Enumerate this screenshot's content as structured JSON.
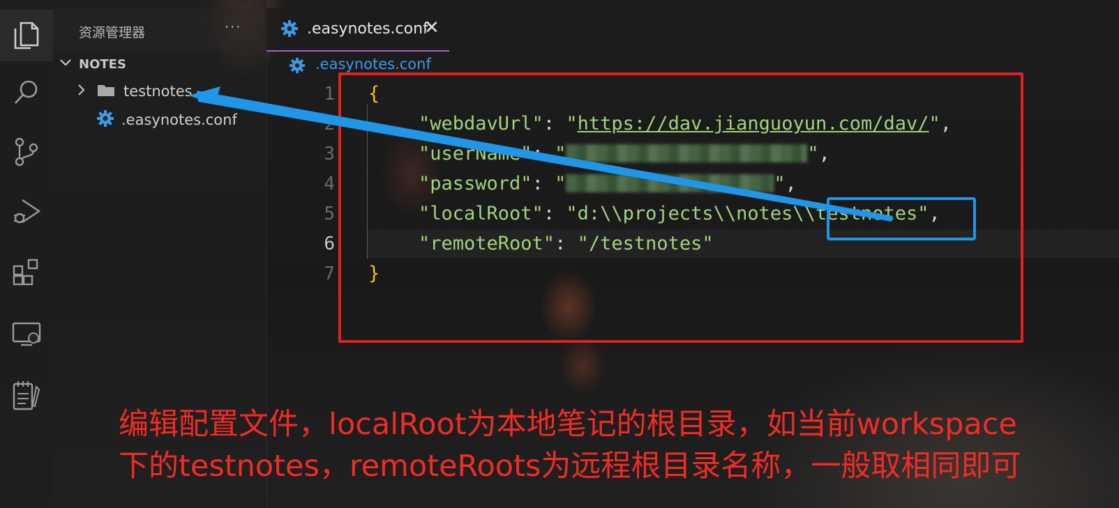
{
  "sidebar": {
    "title": "资源管理器",
    "more": "···",
    "section": "NOTES",
    "items": [
      {
        "label": "testnotes",
        "icon": "folder-icon"
      },
      {
        "label": ".easynotes.conf",
        "icon": "gear-icon"
      }
    ]
  },
  "activitybar": {
    "items": [
      "explorer-icon",
      "search-icon",
      "source-control-icon",
      "debug-icon",
      "extensions-icon",
      "remote-explorer-icon",
      "notes-icon"
    ]
  },
  "tab": {
    "label": ".easynotes.conf",
    "close": "✕"
  },
  "breadcrumb": ".easynotes.conf",
  "editor": {
    "line_numbers": [
      "1",
      "2",
      "3",
      "4",
      "5",
      "6",
      "7"
    ],
    "active_line": "6",
    "lines": {
      "l1": "{",
      "l2_key": "\"webdavUrl\"",
      "l2_val": "https://dav.jianguoyun.com/dav/",
      "l3_key": "\"userName\"",
      "l4_key": "\"password\"",
      "l5_key": "\"localRoot\"",
      "l5_val": "\"d:\\\\projects\\\\notes\\\\testnotes\"",
      "l6_key": "\"remoteRoot\"",
      "l6_val": "\"/testnotes\"",
      "l7": "}"
    }
  },
  "annotation": {
    "line1": "编辑配置文件，localRoot为本地笔记的根目录，如当前workspace",
    "line2": "下的testnotes，remoteRoots为远程根目录名称，一般取相同即可"
  },
  "colors": {
    "highlight_box": "#e0211e",
    "focus_box": "#1f96e8",
    "annotation_text": "#f02c24",
    "tab_accent": "#b05cc8"
  }
}
